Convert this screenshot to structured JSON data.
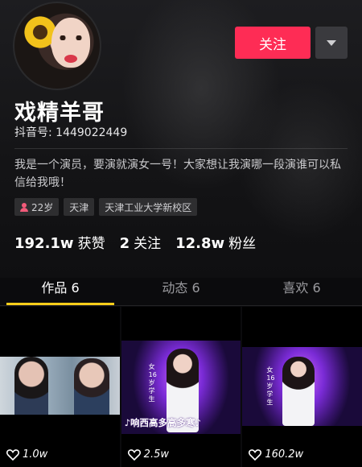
{
  "profile": {
    "nickname": "戏精羊哥",
    "account_id": "抖音号: 1449022449",
    "bio": "我是一个演员，要演就演女一号！大家想让我演哪一段演谁可以私信给我哦！",
    "tags": {
      "age": "22岁",
      "city": "天津",
      "school": "天津工业大学新校区"
    }
  },
  "actions": {
    "follow_label": "关注",
    "more_icon": "chevron-down-icon"
  },
  "stats": {
    "likes_value": "192.1w",
    "likes_label": "获赞",
    "following_value": "2",
    "following_label": "关注",
    "followers_value": "12.8w",
    "followers_label": "粉丝"
  },
  "tabs": [
    {
      "label": "作品 6",
      "active": true
    },
    {
      "label": "动态 6",
      "active": false
    },
    {
      "label": "喜欢 6",
      "active": false
    }
  ],
  "videos": [
    {
      "likes": "1.0w",
      "caption": ""
    },
    {
      "likes": "2.5w",
      "caption": "♪响西高多高多寒♪",
      "side_tag": "女 16岁 学生"
    },
    {
      "likes": "160.2w",
      "caption": "",
      "side_tag": "女 16岁 学生"
    }
  ],
  "colors": {
    "accent": "#fe2c55",
    "tab_underline": "#fcce1a",
    "background": "#0b0b0d"
  }
}
